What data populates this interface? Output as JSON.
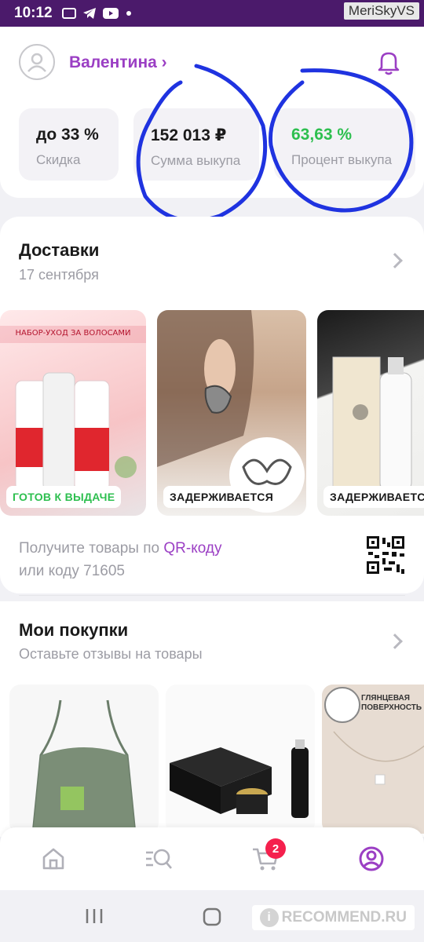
{
  "status_bar": {
    "time": "10:12"
  },
  "watermark_top": "MeriSkyVS",
  "watermark_bottom": "RECOMMEND.RU",
  "profile": {
    "username": "Валентина ›"
  },
  "stats": [
    {
      "value": "до 33 %",
      "label": "Скидка"
    },
    {
      "value": "152 013 ₽",
      "label": "Сумма выкупа"
    },
    {
      "value": "63,63 %",
      "label": "Процент выкупа"
    }
  ],
  "deliveries": {
    "title": "Доставки",
    "date": "17 сентября",
    "items": [
      {
        "status": "ГОТОВ К ВЫДАЧЕ",
        "image": "hair-care-set-image"
      },
      {
        "status": "ЗАДЕРЖИВАЕТСЯ",
        "image": "butterfly-earrings-image"
      },
      {
        "status": "ЗАДЕРЖИВАЕТСЯ",
        "image": "cosmetics-bottle-image"
      }
    ],
    "qr_text_prefix": "Получите товары по ",
    "qr_link": "QR-коду",
    "qr_text_line2": "или коду 71605"
  },
  "purchases": {
    "title": "Мои покупки",
    "subtitle": "Оставьте отзывы на товары",
    "items": [
      {
        "image": "green-top-image"
      },
      {
        "image": "cosmetics-box-image"
      },
      {
        "image": "necklace-image",
        "tag": "ГЛЯНЦЕВАЯ ПОВЕРХНОСТЬ"
      }
    ]
  },
  "nav": {
    "cart_count": "2"
  },
  "colors": {
    "accent": "#9b3fc4",
    "green": "#2dbf4f",
    "badge": "#f5204d",
    "status_bar": "#4b1a6b"
  }
}
